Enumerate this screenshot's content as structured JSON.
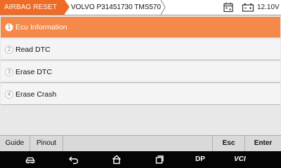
{
  "header": {
    "breadcrumb_active": "AIRBAG RESET",
    "breadcrumb_current": "VOLVO P31451730 TMS570",
    "battery_voltage": "12.10V",
    "accent_color": "#ee6c25"
  },
  "menu": {
    "items": [
      {
        "num": "1",
        "label": "Ecu Information",
        "selected": true
      },
      {
        "num": "2",
        "label": "Read DTC",
        "selected": false
      },
      {
        "num": "3",
        "label": "Erase DTC",
        "selected": false
      },
      {
        "num": "4",
        "label": "Erase Crash",
        "selected": false
      }
    ]
  },
  "function_bar": {
    "guide": "Guide",
    "pinout": "Pinout",
    "esc": "Esc",
    "enter": "Enter"
  },
  "nav_bar": {
    "icons": [
      "car-icon",
      "back-icon",
      "home-icon",
      "recent-apps-icon"
    ],
    "dp": "DP",
    "vci": "VCI"
  }
}
